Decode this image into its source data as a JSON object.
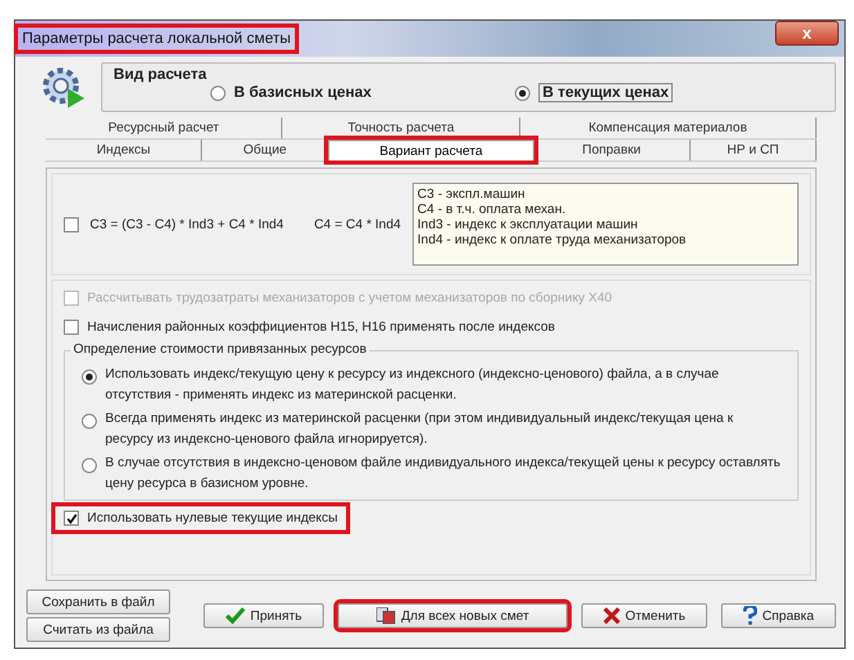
{
  "window": {
    "title": "Параметры расчета локальной сметы",
    "title_highlighted": true,
    "close": "x"
  },
  "calc_type": {
    "legend": "Вид расчета",
    "options": [
      {
        "label": "В базисных ценах",
        "selected": false
      },
      {
        "label": "В текущих ценах",
        "selected": true
      }
    ]
  },
  "tabs_back": [
    {
      "label": "Ресурсный расчет",
      "selected": false,
      "highlighted": false
    },
    {
      "label": "Точность расчета",
      "selected": false,
      "highlighted": false
    },
    {
      "label": "Компенсация материалов",
      "selected": false,
      "highlighted": false
    }
  ],
  "tabs_front": [
    {
      "label": "Индексы",
      "selected": false,
      "highlighted": false
    },
    {
      "label": "Общие",
      "selected": false,
      "highlighted": false
    },
    {
      "label": "Вариант расчета",
      "selected": true,
      "highlighted": true
    },
    {
      "label": "Поправки",
      "selected": false,
      "highlighted": false
    },
    {
      "label": "НР и СП",
      "selected": false,
      "highlighted": false
    }
  ],
  "formula": {
    "label": "C3 = (C3 - C4) * Ind3 + C4 * Ind4",
    "checked": false,
    "secondary": "C4 = C4 * Ind4",
    "legend_lines": [
      "C3 - экспл.машин",
      "C4 - в т.ч. оплата механ.",
      "Ind3 - индекс к эксплуатации машин",
      "Ind4 - индекс к оплате труда механизаторов"
    ]
  },
  "options": [
    {
      "label": "Рассчитывать трудозатраты механизаторов с учетом механизаторов по сборнику Х40",
      "checked": false,
      "disabled": true
    },
    {
      "label": "Начисления районных коэффициентов Н15, Н16 применять после индексов",
      "checked": false,
      "disabled": false
    }
  ],
  "resources": {
    "legend": "Определение стоимости привязанных ресурсов",
    "options": [
      {
        "label": "Использовать индекс/текущую цену к ресурсу из индексного (индексно-ценового) файла, а в случае отсутствия - применять индекс из материнской расценки.",
        "selected": true
      },
      {
        "label": "Всегда применять индекс из материнской расценки (при этом индивидуальный индекс/текущая цена к ресурсу из индексно-ценового файла игнорируется).",
        "selected": false
      },
      {
        "label": "В случае отсутствия в индексно-ценовом файле индивидуального индекса/текущей цены к ресурсу оставлять цену ресурса в базисном уровне.",
        "selected": false
      }
    ]
  },
  "zero_indexes": {
    "label": "Использовать нулевые текущие индексы",
    "checked": true,
    "highlighted": true
  },
  "file_buttons": [
    "Сохранить в файл",
    "Считать из файла"
  ],
  "buttons": [
    {
      "kind": "ok",
      "label": "Принять",
      "highlighted": false
    },
    {
      "kind": "all",
      "label": "Для всех новых смет",
      "highlighted": true
    },
    {
      "kind": "cancel",
      "label": "Отменить",
      "highlighted": false
    },
    {
      "kind": "help",
      "label": "Справка",
      "highlighted": false
    }
  ]
}
